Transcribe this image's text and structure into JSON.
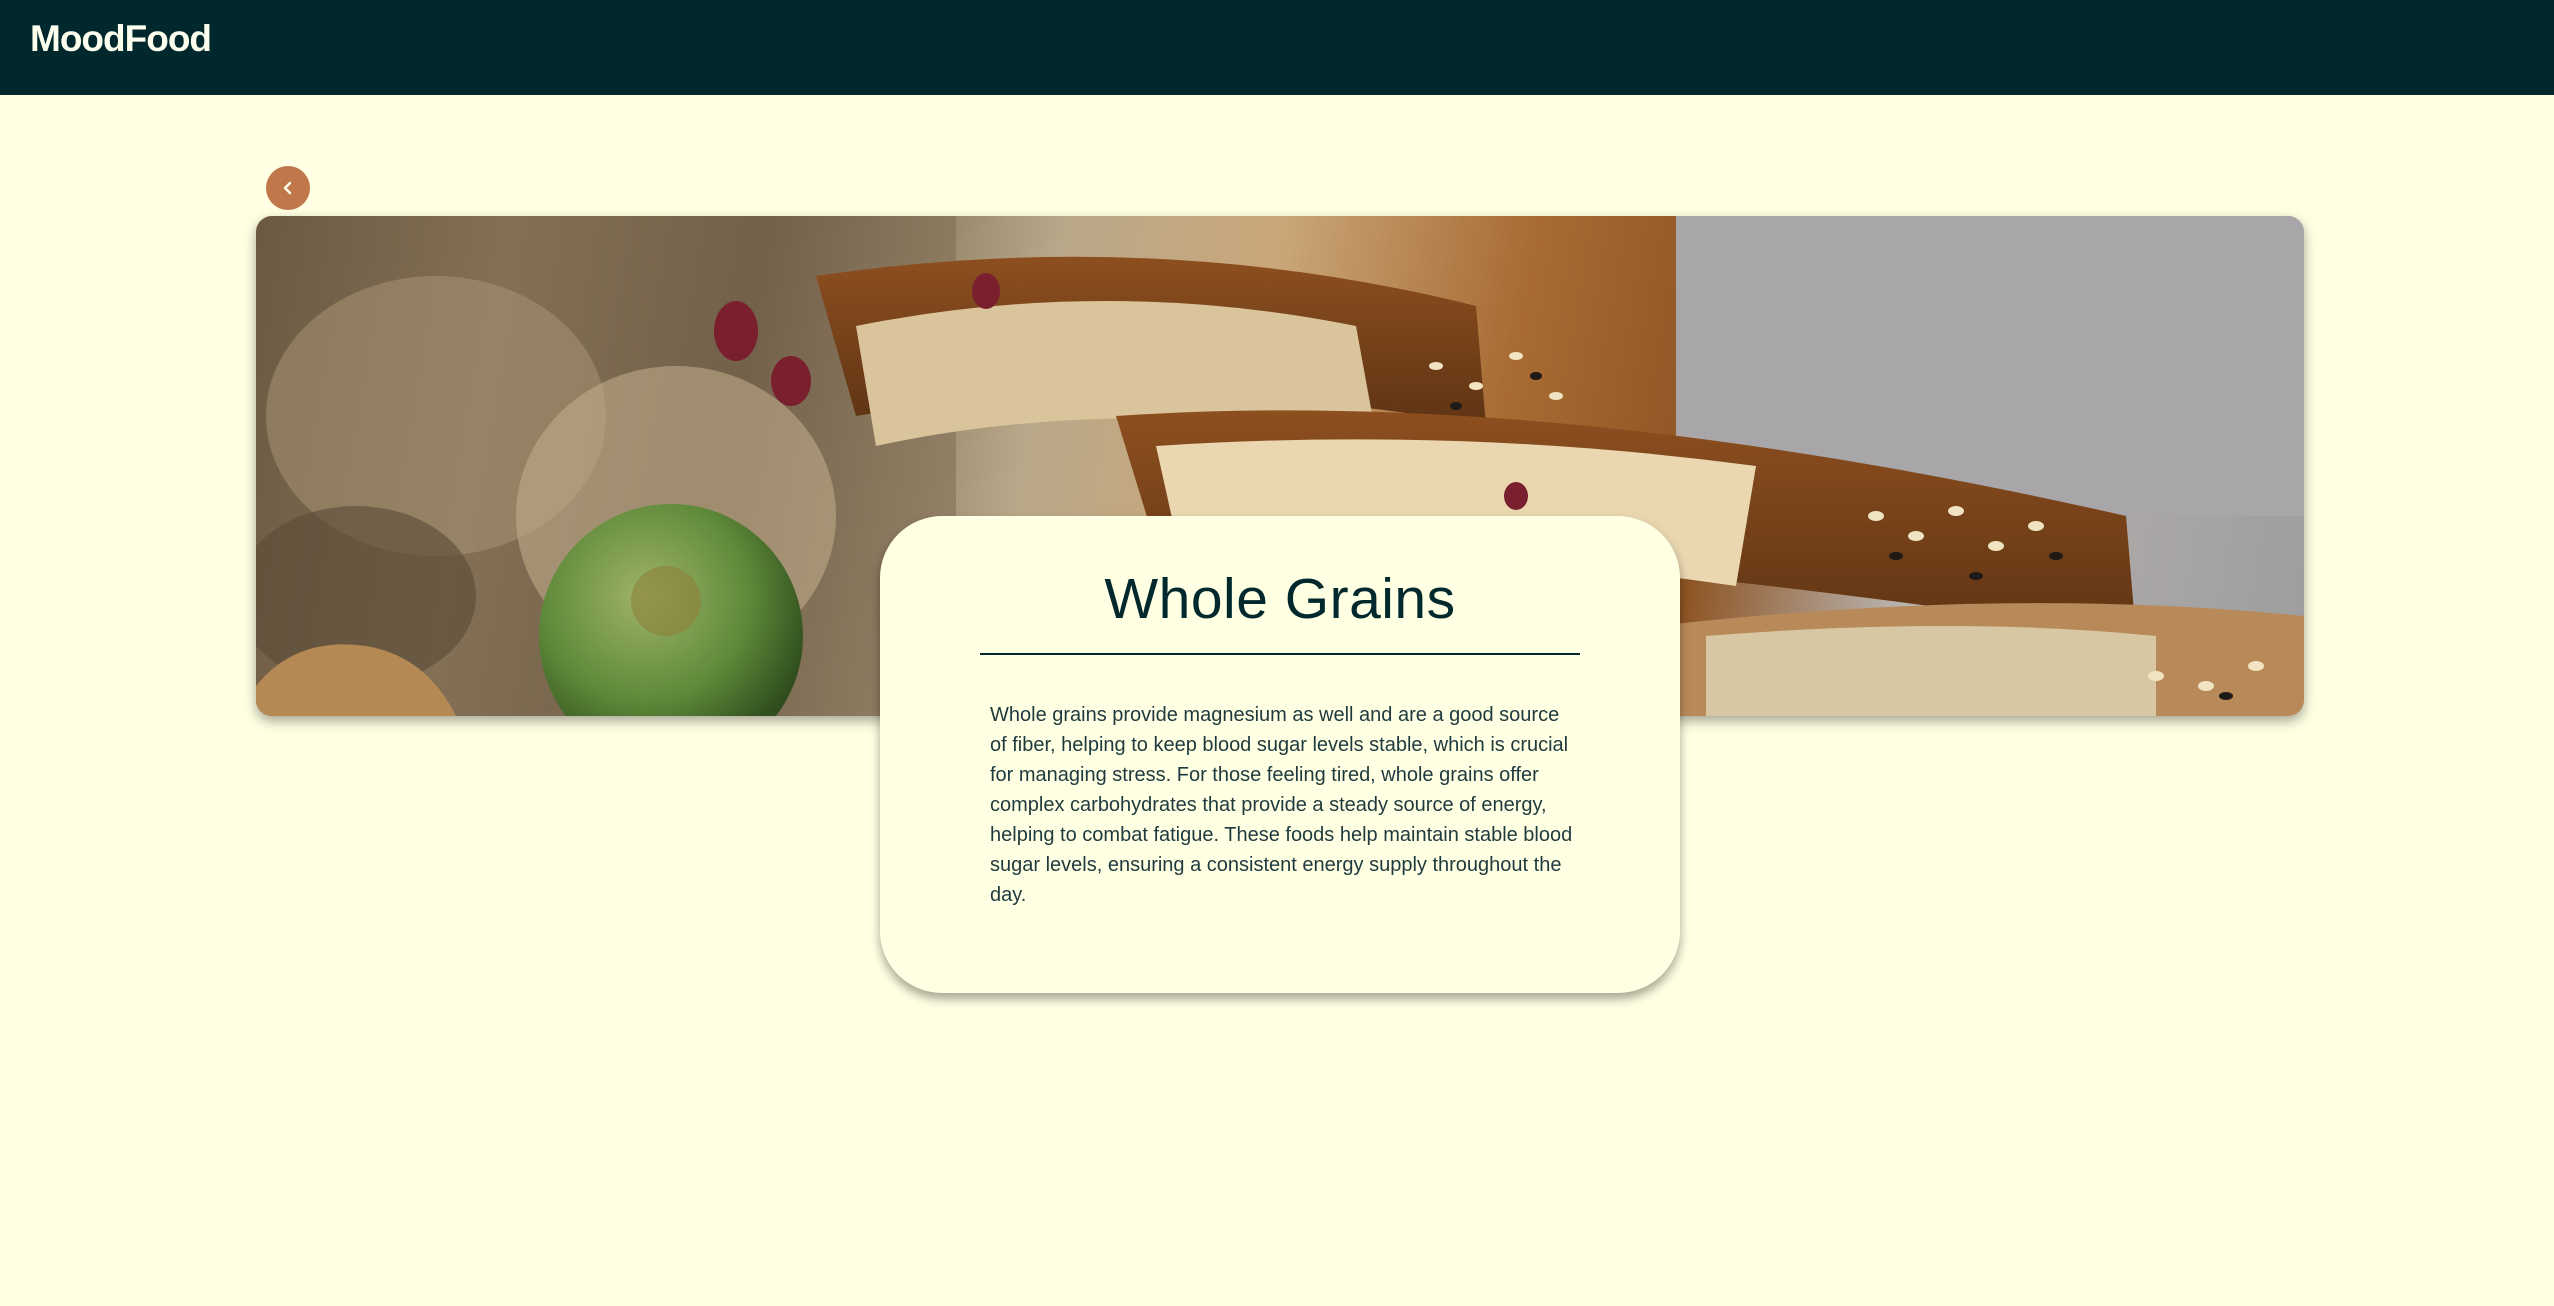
{
  "app": {
    "brand": "MoodFood"
  },
  "navigation": {
    "back_icon": "chevron-left-icon"
  },
  "hero": {
    "image_description_icon": "food-photo"
  },
  "food_card": {
    "title": "Whole Grains",
    "description": "Whole grains provide magnesium as well and are a good source of fiber, helping to keep blood sugar levels stable, which is crucial for managing stress. For those feeling tired, whole grains offer complex carbohydrates that provide a steady source of energy, helping to combat fatigue. These foods help maintain stable blood sugar levels, ensuring a consistent energy supply throughout the day."
  },
  "colors": {
    "header_bg": "#00282D",
    "page_bg": "#FFFFE3",
    "accent": "#C0784A",
    "text_dark": "#00282D"
  }
}
